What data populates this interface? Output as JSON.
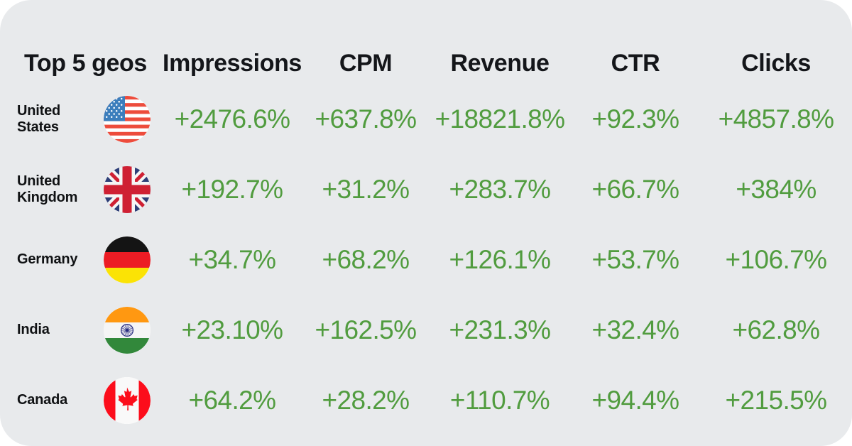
{
  "card": {
    "background_color": "#e8eaec",
    "corner_radius_px": 44
  },
  "theme": {
    "positive_color": "#519c3f",
    "text_color": "#14161a",
    "page_background": "#ffffff"
  },
  "table": {
    "columns": [
      {
        "key": "geo",
        "label": "Top 5 geos"
      },
      {
        "key": "impressions",
        "label": "Impressions"
      },
      {
        "key": "cpm",
        "label": "CPM"
      },
      {
        "key": "revenue",
        "label": "Revenue"
      },
      {
        "key": "ctr",
        "label": "CTR"
      },
      {
        "key": "clicks",
        "label": "Clicks"
      }
    ],
    "rows": [
      {
        "geo": "United\nStates",
        "flag_icon": "flag-united-states-icon",
        "impressions": "+2476.6%",
        "cpm": "+637.8%",
        "revenue": "+18821.8%",
        "ctr": "+92.3%",
        "clicks": "+4857.8%"
      },
      {
        "geo": "United\nKingdom",
        "flag_icon": "flag-united-kingdom-icon",
        "impressions": "+192.7%",
        "cpm": "+31.2%",
        "revenue": "+283.7%",
        "ctr": "+66.7%",
        "clicks": "+384%"
      },
      {
        "geo": "Germany",
        "flag_icon": "flag-germany-icon",
        "impressions": "+34.7%",
        "cpm": "+68.2%",
        "revenue": "+126.1%",
        "ctr": "+53.7%",
        "clicks": "+106.7%"
      },
      {
        "geo": "India",
        "flag_icon": "flag-india-icon",
        "impressions": "+23.10%",
        "cpm": "+162.5%",
        "revenue": "+231.3%",
        "ctr": "+32.4%",
        "clicks": "+62.8%"
      },
      {
        "geo": "Canada",
        "flag_icon": "flag-canada-icon",
        "impressions": "+64.2%",
        "cpm": "+28.2%",
        "revenue": "+110.7%",
        "ctr": "+94.4%",
        "clicks": "+215.5%"
      }
    ]
  },
  "chart_data": {
    "type": "table",
    "title": "Top 5 geos",
    "columns": [
      "Top 5 geos",
      "Impressions",
      "CPM",
      "Revenue",
      "CTR",
      "Clicks"
    ],
    "categories": [
      "United States",
      "United Kingdom",
      "Germany",
      "India",
      "Canada"
    ],
    "series": [
      {
        "name": "Impressions",
        "values": [
          2476.6,
          192.7,
          34.7,
          23.1,
          64.2
        ],
        "unit": "percent_change"
      },
      {
        "name": "CPM",
        "values": [
          637.8,
          31.2,
          68.2,
          162.5,
          28.2
        ],
        "unit": "percent_change"
      },
      {
        "name": "Revenue",
        "values": [
          18821.8,
          283.7,
          126.1,
          231.3,
          110.7
        ],
        "unit": "percent_change"
      },
      {
        "name": "CTR",
        "values": [
          92.3,
          66.7,
          53.7,
          32.4,
          94.4
        ],
        "unit": "percent_change"
      },
      {
        "name": "Clicks",
        "values": [
          4857.8,
          384,
          106.7,
          62.8,
          215.5
        ],
        "unit": "percent_change"
      }
    ],
    "all_positive": true,
    "legend": "none",
    "grid": false
  }
}
